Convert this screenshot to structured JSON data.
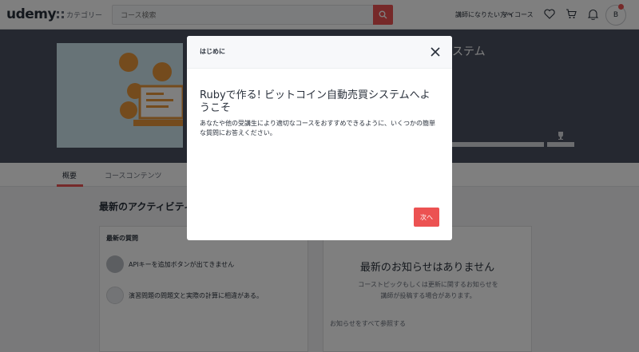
{
  "nav": {
    "logo": "udemy",
    "categories_label": "カテゴリー",
    "search_placeholder": "コース検索",
    "links": [
      "講師になりたい方へ",
      "マイコース"
    ],
    "avatar_initial": "B"
  },
  "course": {
    "title_fragment": "ステム"
  },
  "tabs": [
    "概要",
    "コースコンテンツ"
  ],
  "activity": {
    "section_title": "最新のアクティビティ",
    "questions_heading": "最新の質問",
    "questions": [
      {
        "text": "APIキーを追加ボタンが出てきません"
      },
      {
        "text": "演習問題の問題文と実際の計算に相違がある。"
      }
    ],
    "announcements": {
      "title": "最新のお知らせはありません",
      "desc": "コーストピックもしくは更新に関するお知らせを講師が投稿する場合があります。",
      "link": "お知らせをすべて参照する"
    }
  },
  "modal": {
    "title": "はじめに",
    "heading": "Rubyで作る! ビットコイン自動売買システムへようこそ",
    "body": "あなたや他の受講生により適切なコースをおすすめできるように、いくつかの簡単な質問にお答えください。",
    "next_label": "次へ"
  },
  "colors": {
    "accent": "#ec5252",
    "text": "#29303b",
    "header_band": "#4a5060"
  }
}
